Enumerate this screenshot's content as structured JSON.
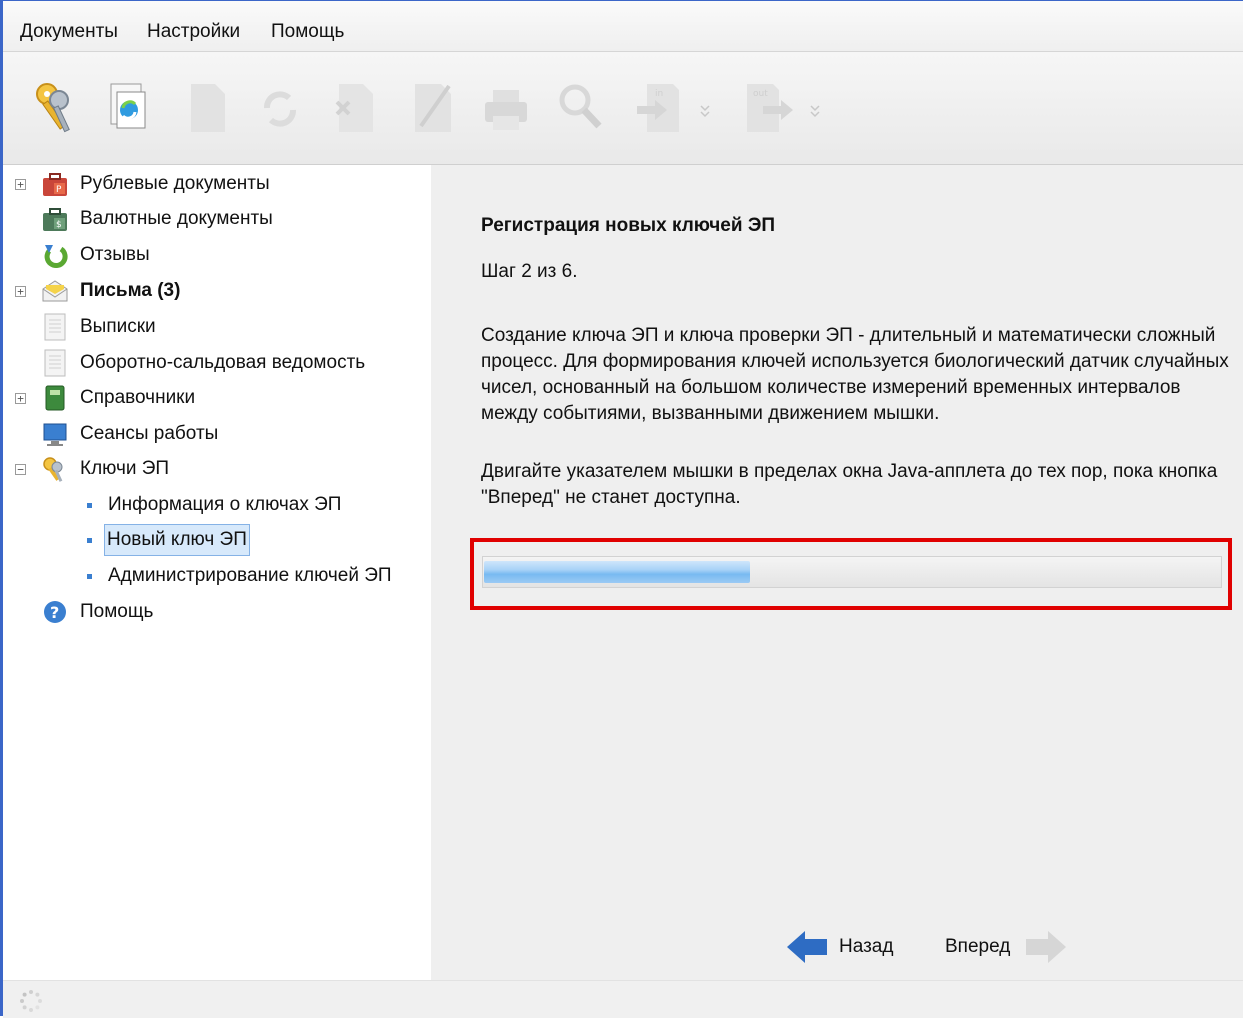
{
  "menu": {
    "items": [
      "Документы",
      "Настройки",
      "Помощь"
    ]
  },
  "toolbar": {
    "buttons": [
      {
        "icon": "keys-icon",
        "enabled": true
      },
      {
        "icon": "refresh-document-icon",
        "enabled": true
      },
      {
        "icon": "new-document-icon",
        "enabled": false
      },
      {
        "icon": "sync-icon",
        "enabled": false
      },
      {
        "icon": "delete-document-icon",
        "enabled": false
      },
      {
        "icon": "edit-document-icon",
        "enabled": false
      },
      {
        "icon": "print-icon",
        "enabled": false
      },
      {
        "icon": "search-icon",
        "enabled": false
      },
      {
        "icon": "import-icon",
        "enabled": false,
        "text": "in"
      },
      {
        "icon": "export-icon",
        "enabled": false,
        "text": "out"
      }
    ]
  },
  "sidebar": {
    "items": [
      {
        "label": "Рублевые документы",
        "icon": "ruble-briefcase-icon",
        "expander": "+"
      },
      {
        "label": "Валютные документы",
        "icon": "dollar-briefcase-icon"
      },
      {
        "label": "Отзывы",
        "icon": "revoke-arrow-icon"
      },
      {
        "label": "Письма (3)",
        "icon": "envelope-icon",
        "expander": "+",
        "bold": true
      },
      {
        "label": "Выписки",
        "icon": "statement-document-icon"
      },
      {
        "label": "Оборотно-сальдовая ведомость",
        "icon": "balance-sheet-icon"
      },
      {
        "label": "Справочники",
        "icon": "reference-book-icon",
        "expander": "+"
      },
      {
        "label": "Сеансы работы",
        "icon": "monitor-icon"
      },
      {
        "label": "Ключи ЭП",
        "icon": "keys-icon",
        "expander": "−"
      },
      {
        "label": "Информация о ключах ЭП",
        "child": true
      },
      {
        "label": "Новый ключ ЭП",
        "child": true,
        "selected": true
      },
      {
        "label": "Администрирование ключей ЭП",
        "child": true
      },
      {
        "label": "Помощь",
        "icon": "help-icon"
      }
    ]
  },
  "main": {
    "title": "Регистрация новых ключей ЭП",
    "step": "Шаг 2 из 6.",
    "paragraph1": "Создание ключа ЭП и ключа проверки ЭП - длительный и математически сложный процесс. Для формирования ключей используется биологический датчик случайных чисел, основанный на большом количестве измерений временных интервалов между событиями, вызванными движением мышки.",
    "paragraph2": "Двигайте указателем мышки в пределах окна Java-апплета до тех пор, пока кнопка \"Вперед\" не станет доступна.",
    "progress_percent": 36,
    "back_label": "Назад",
    "forward_label": "Вперед",
    "forward_enabled": false
  },
  "colors": {
    "accent": "#3b66c8",
    "highlight_frame": "#e00000",
    "progress": "#78baf1",
    "back_arrow": "#2e6cc3",
    "disabled": "#d0d0d0"
  }
}
